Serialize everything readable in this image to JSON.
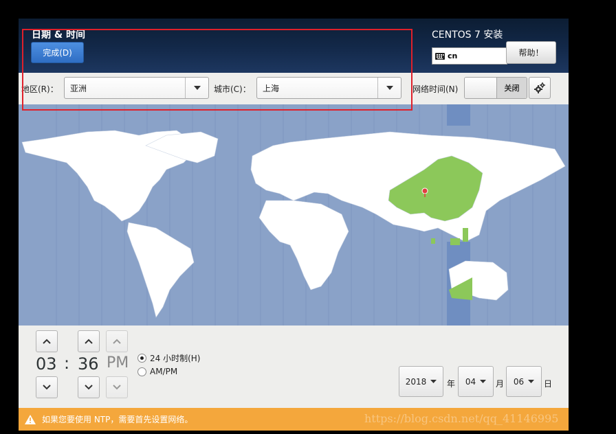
{
  "header": {
    "title": "日期 & 时间",
    "done_label": "完成(D)",
    "product_title": "CENTOS 7 安装",
    "keyboard_layout": "cn",
    "help_label": "帮助！"
  },
  "toolbar": {
    "region_label": "地区(R)：",
    "region_value": "亚洲",
    "city_label": "城市(C)：",
    "city_value": "上海",
    "ntp_label": "网络时间(N)",
    "ntp_state": "关闭"
  },
  "time": {
    "hours": "03",
    "separator": ":",
    "minutes": "36",
    "ampm": "PM",
    "format_24h_label": "24 小时制(H)",
    "format_ampm_label": "AM/PM",
    "format_24h_selected": true
  },
  "date": {
    "year": "2018",
    "year_unit": "年",
    "month": "04",
    "month_unit": "月",
    "day": "06",
    "day_unit": "日"
  },
  "warning": {
    "text": "如果您要使用 NTP，需要首先设置网络。"
  },
  "watermark": "https://blog.csdn.net/qq_41146995",
  "colors": {
    "header_bg": "#13294a",
    "done_button": "#3b7dd8",
    "map_ocean": "#8aa2c8",
    "map_timezone_highlight": "#6f8ec1",
    "selected_country": "#8cc85a",
    "warning_bar": "#f4a73c",
    "annotation": "#e0202a"
  }
}
